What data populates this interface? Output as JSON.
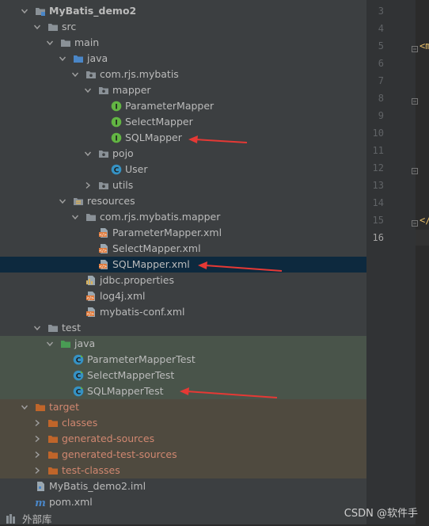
{
  "project_tree": {
    "items": [
      {
        "label": "MyBatis_demo2",
        "icon": "module-folder-icon"
      },
      {
        "label": "src",
        "icon": "folder-icon"
      },
      {
        "label": "main",
        "icon": "folder-icon"
      },
      {
        "label": "java",
        "icon": "source-root-folder-icon"
      },
      {
        "label": "com.rjs.mybatis",
        "icon": "package-icon"
      },
      {
        "label": "mapper",
        "icon": "package-icon"
      },
      {
        "label": "ParameterMapper",
        "icon": "interface-icon"
      },
      {
        "label": "SelectMapper",
        "icon": "interface-icon"
      },
      {
        "label": "SQLMapper",
        "icon": "interface-icon"
      },
      {
        "label": "pojo",
        "icon": "package-icon"
      },
      {
        "label": "User",
        "icon": "class-icon"
      },
      {
        "label": "utils",
        "icon": "package-icon"
      },
      {
        "label": "resources",
        "icon": "resources-folder-icon"
      },
      {
        "label": "com.rjs.mybatis.mapper",
        "icon": "folder-icon"
      },
      {
        "label": "ParameterMapper.xml",
        "icon": "xml-file-icon"
      },
      {
        "label": "SelectMapper.xml",
        "icon": "xml-file-icon"
      },
      {
        "label": "SQLMapper.xml",
        "icon": "xml-file-icon"
      },
      {
        "label": "jdbc.properties",
        "icon": "properties-file-icon"
      },
      {
        "label": "log4j.xml",
        "icon": "xml-file-icon"
      },
      {
        "label": "mybatis-conf.xml",
        "icon": "xml-file-icon"
      },
      {
        "label": "test",
        "icon": "folder-icon"
      },
      {
        "label": "java",
        "icon": "test-root-folder-icon"
      },
      {
        "label": "ParameterMapperTest",
        "icon": "test-class-icon"
      },
      {
        "label": "SelectMapperTest",
        "icon": "test-class-icon"
      },
      {
        "label": "SQLMapperTest",
        "icon": "test-class-icon"
      },
      {
        "label": "target",
        "icon": "excluded-folder-icon"
      },
      {
        "label": "classes",
        "icon": "excluded-folder-icon"
      },
      {
        "label": "generated-sources",
        "icon": "excluded-folder-icon"
      },
      {
        "label": "generated-test-sources",
        "icon": "excluded-folder-icon"
      },
      {
        "label": "test-classes",
        "icon": "excluded-folder-icon"
      },
      {
        "label": "MyBatis_demo2.iml",
        "icon": "iml-file-icon"
      },
      {
        "label": "pom.xml",
        "icon": "maven-icon"
      }
    ],
    "external_libraries_label": "外部库"
  },
  "editor": {
    "line_numbers": [
      "3",
      "4",
      "5",
      "6",
      "7",
      "8",
      "9",
      "10",
      "11",
      "12",
      "13",
      "14",
      "15",
      "16"
    ],
    "active_line": "16",
    "code_fragments": [
      "<m",
      "</"
    ]
  },
  "watermark": "CSDN @软件手",
  "colors": {
    "panel_bg": "#3c3f41",
    "selection": "#0d293e",
    "test_band": "#49544a",
    "excluded_band": "#4f4a3f",
    "annotation_arrow": "#e53935",
    "folder": "#8a9197",
    "source_folder": "#4a86c7",
    "test_folder": "#499c54",
    "excluded_folder": "#c0652a"
  }
}
